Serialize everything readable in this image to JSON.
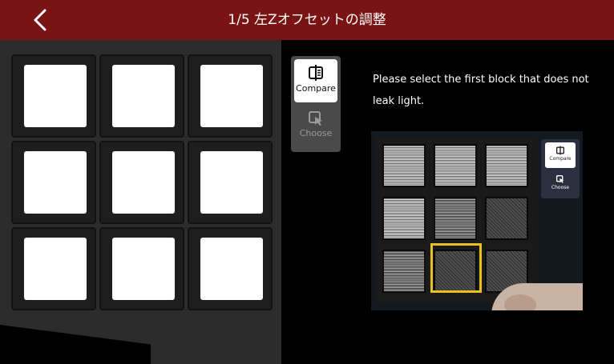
{
  "header": {
    "title": "1/5 左Zオフセットの調整"
  },
  "mode_switch": {
    "compare_label": "Compare",
    "choose_label": "Choose"
  },
  "instruction": "Please select the first block that does not leak light.",
  "example_photo": {
    "mini_compare_label": "Compare",
    "mini_choose_label": "Choose"
  },
  "colors": {
    "header_bg": "#7a1414",
    "left_panel_bg": "#2c2c2c",
    "highlight": "#e8c020"
  }
}
